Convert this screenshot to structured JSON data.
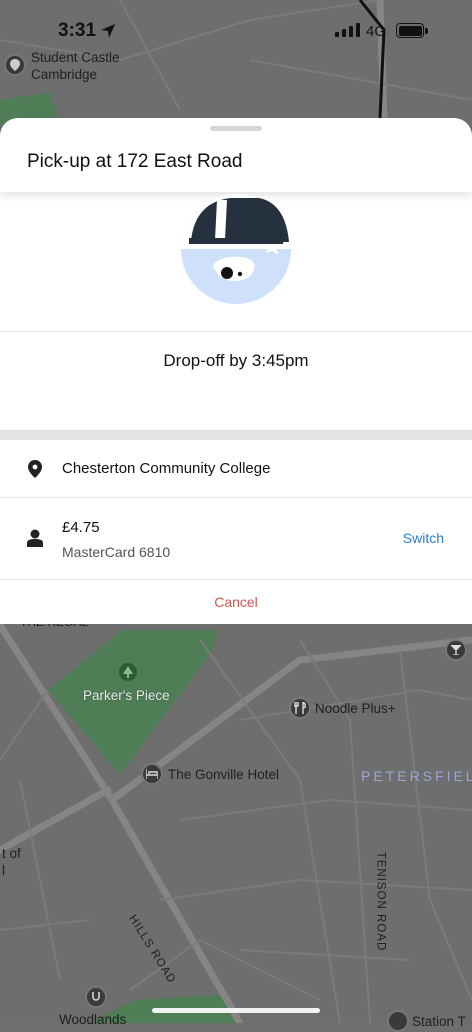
{
  "status_bar": {
    "time": "3:31",
    "network": "4G"
  },
  "map": {
    "labels": {
      "student_castle": "Student Castle\nCambridge",
      "the_regal": "THE REGAL",
      "parkers_piece": "Parker's Piece",
      "noodle_plus": "Noodle Plus+",
      "gonville_hotel": "The Gonville Hotel",
      "petersfield": "PETERSFIEL",
      "hills_road": "HILLS ROAD",
      "tenison_road": "TENISON ROAD",
      "woodlands": "Woodlands",
      "station": "Station T",
      "left_partial": "t of\nl"
    }
  },
  "sheet": {
    "title": "Pick-up at 172 East Road",
    "dropoff": "Drop-off by 3:45pm",
    "destination": "Chesterton Community College",
    "payment": {
      "price": "£4.75",
      "card": "MasterCard 6810",
      "switch_label": "Switch"
    },
    "cancel_label": "Cancel"
  },
  "colors": {
    "accent_blue": "#2b7bd6",
    "cancel_red": "#d9534f",
    "map_bg": "#6f6f6f",
    "park_green": "#4e7d56"
  }
}
